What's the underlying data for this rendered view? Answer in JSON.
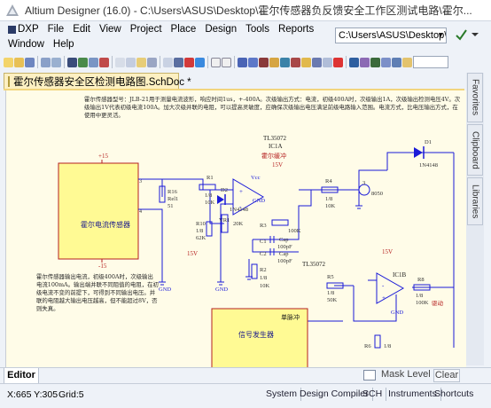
{
  "window": {
    "title": "Altium Designer (16.0) - C:\\Users\\ASUS\\Desktop\\霍尔传感器负反馈安全工作区测试电路\\霍尔..."
  },
  "menu": [
    "DXP",
    "File",
    "Edit",
    "View",
    "Project",
    "Place",
    "Design",
    "Tools",
    "Reports",
    "Window",
    "Help"
  ],
  "path_combo": "C:\\Users\\ASUS\\Desktop\\",
  "document_tab": "霍尔传感器安全区检测电路图.SchDoc *",
  "side_panels": [
    "Favorites",
    "Clipboard",
    "Libraries"
  ],
  "schematic": {
    "note_top": "霍尔传感器型号：JLB-21用于测量电流波形，响应时间1us，+-400A。次级输出方式：电流，初级400A时，次级输出1A，次级输出检测电压4V。次级输出1V代表初级电流100A。加大次级并联的电阻，可以提高灵敏度，应确保次级输出电压满足前级电路输入范围。电流方式，比电压输出方式，在使用中更灵活。",
    "note_bottom": "霍尔传感器输出电流，初级400A时，次级输出电流100mA。输出端并联不同阻值的电阻，在初级电流不变的前提下，可得到不同输出电压。并联的电阻越大输出电压越高，但不能超过8V，否则失真。",
    "labels": {
      "hall_block": "霍尔电流传感器",
      "signal_block": "信号发生器",
      "pulse": "单脉冲",
      "drive": "驱动",
      "hall_buffer": "霍尔缓冲",
      "plus15": "+15",
      "minus15": "-15",
      "v15a": "15V",
      "v15b": "15V",
      "v15c": "15V",
      "vcc": "Vcc",
      "gnd": "GND",
      "tl1": "TL35072",
      "tl2": "TL35072",
      "ic1a": "IC1A",
      "ic1b": "IC1B",
      "r1": "R1",
      "r1v": "1/8",
      "r1o": "10K",
      "r16": "R16",
      "r16v": "Rel1",
      "r16o": "51",
      "d2": "D2",
      "d2v": "1N4148",
      "d1": "D1",
      "d1v": "1N4148",
      "vr1": "VR1",
      "vr1v": "20K",
      "r10": "R10",
      "r10v": "1/8",
      "r10o": "62K",
      "r3": "R3",
      "r3v": "100K",
      "r4": "R4",
      "r4v": "1/8",
      "r4o": "10K",
      "q": "3",
      "q8050": "8050",
      "c1": "C1",
      "c1v": "Cap",
      "c1o": "100pF",
      "c2": "C2",
      "c2v": "Cap",
      "c2o": "100pF",
      "r2": "R2",
      "r2v": "1/8",
      "r2o": "10K",
      "r5": "R5",
      "r5v": "1/8",
      "r5o": "50K",
      "r8": "R8",
      "r8v": "1/8",
      "r8o": "100K",
      "r6": "R6",
      "r6v": "1/8",
      "pin1": "1",
      "pin2": "2",
      "pin3": "3",
      "pin4": "4",
      "plus": "+",
      "minus": "-"
    }
  },
  "editor": {
    "tab": "Editor",
    "mask": "Mask Level",
    "clear": "Clear"
  },
  "status": {
    "coords": "X:665 Y:305",
    "grid": "Grid:5",
    "buttons": [
      "System",
      "Design Compiler",
      "SCH",
      "Instruments",
      "Shortcuts"
    ]
  },
  "colors": {
    "wire": "#1a1ad8",
    "component": "#b52020",
    "block_fill": "#fffa94",
    "canvas": "#fffce8"
  }
}
